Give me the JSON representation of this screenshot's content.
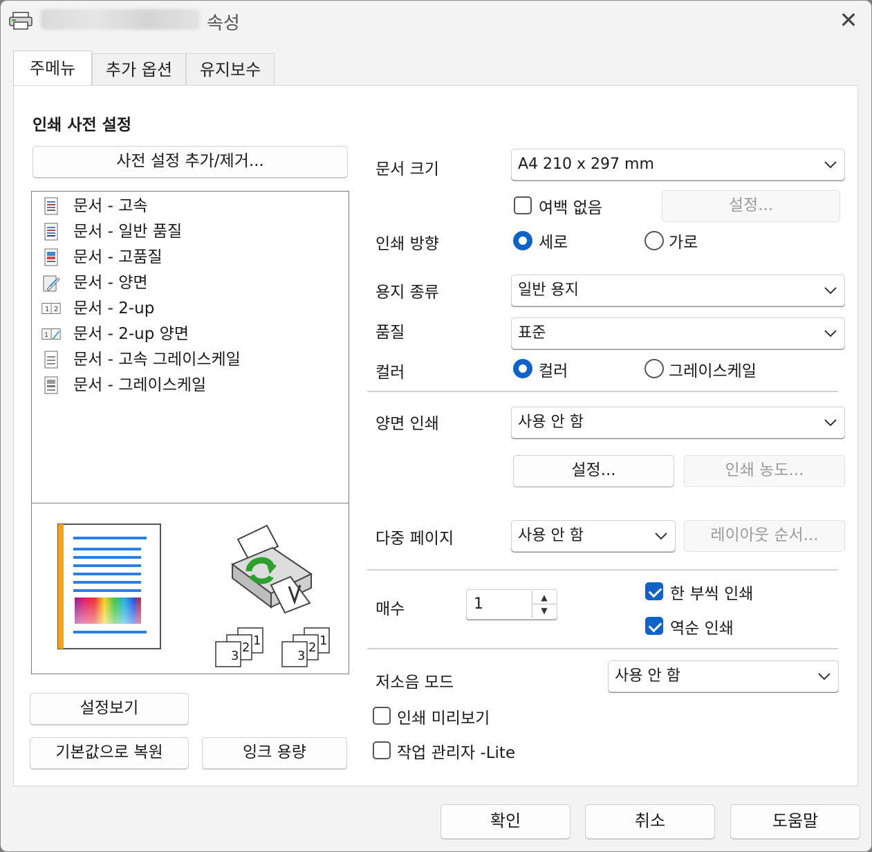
{
  "window": {
    "title": "속성"
  },
  "tabs": [
    {
      "label": "주메뉴",
      "active": true
    },
    {
      "label": "추가 옵션",
      "active": false
    },
    {
      "label": "유지보수",
      "active": false
    }
  ],
  "presets": {
    "title": "인쇄 사전 설정",
    "add_remove_button": "사전 설정 추가/제거...",
    "items": [
      {
        "label": "문서 - 고속",
        "icon": "document-fast-icon"
      },
      {
        "label": "문서 - 일반 품질",
        "icon": "document-normal-icon"
      },
      {
        "label": "문서 - 고품질",
        "icon": "document-high-quality-icon"
      },
      {
        "label": "문서 - 양면",
        "icon": "document-duplex-icon"
      },
      {
        "label": "문서 - 2-up",
        "icon": "two-up-icon"
      },
      {
        "label": "문서 - 2-up 양면",
        "icon": "two-up-duplex-icon"
      },
      {
        "label": "문서 - 고속 그레이스케일",
        "icon": "grayscale-fast-icon"
      },
      {
        "label": "문서 - 그레이스케일",
        "icon": "grayscale-icon"
      }
    ]
  },
  "preview": {
    "collate_left": [
      "3",
      "2",
      "1"
    ],
    "collate_right": [
      "3",
      "2",
      "1"
    ]
  },
  "left_buttons": {
    "show_settings": "설정보기",
    "restore_defaults": "기본값으로 복원",
    "ink_levels": "잉크 용량"
  },
  "settings": {
    "document_size": {
      "label": "문서 크기",
      "value": "A4 210 x 297 mm"
    },
    "borderless": {
      "label": "여백 없음",
      "checked": false,
      "settings_button": "설정..."
    },
    "orientation": {
      "label": "인쇄 방향",
      "portrait": "세로",
      "landscape": "가로",
      "selected": "portrait"
    },
    "paper_type": {
      "label": "용지 종류",
      "value": "일반 용지"
    },
    "quality": {
      "label": "품질",
      "value": "표준"
    },
    "color": {
      "label": "컬러",
      "color": "컬러",
      "grayscale": "그레이스케일",
      "selected": "color"
    },
    "duplex": {
      "label": "양면 인쇄",
      "value": "사용 안 함",
      "settings_button": "설정...",
      "density_button": "인쇄 농도..."
    },
    "multi_page": {
      "label": "다중 페이지",
      "value": "사용 안 함",
      "layout_order_button": "레이아웃 순서..."
    },
    "copies": {
      "label": "매수",
      "value": "1",
      "collate": {
        "label": "한 부씩 인쇄",
        "checked": true
      },
      "reverse": {
        "label": "역순 인쇄",
        "checked": true
      }
    },
    "quiet_mode": {
      "label": "저소음 모드",
      "value": "사용 안 함"
    },
    "print_preview": {
      "label": "인쇄 미리보기",
      "checked": false
    },
    "job_arranger": {
      "label": "작업 관리자 -Lite",
      "checked": false
    }
  },
  "footer": {
    "ok": "확인",
    "cancel": "취소",
    "help": "도움말"
  },
  "colors": {
    "accent": "#0f62c8",
    "page_stripe": "#f7a21b",
    "lines": "#2a7ee8"
  }
}
